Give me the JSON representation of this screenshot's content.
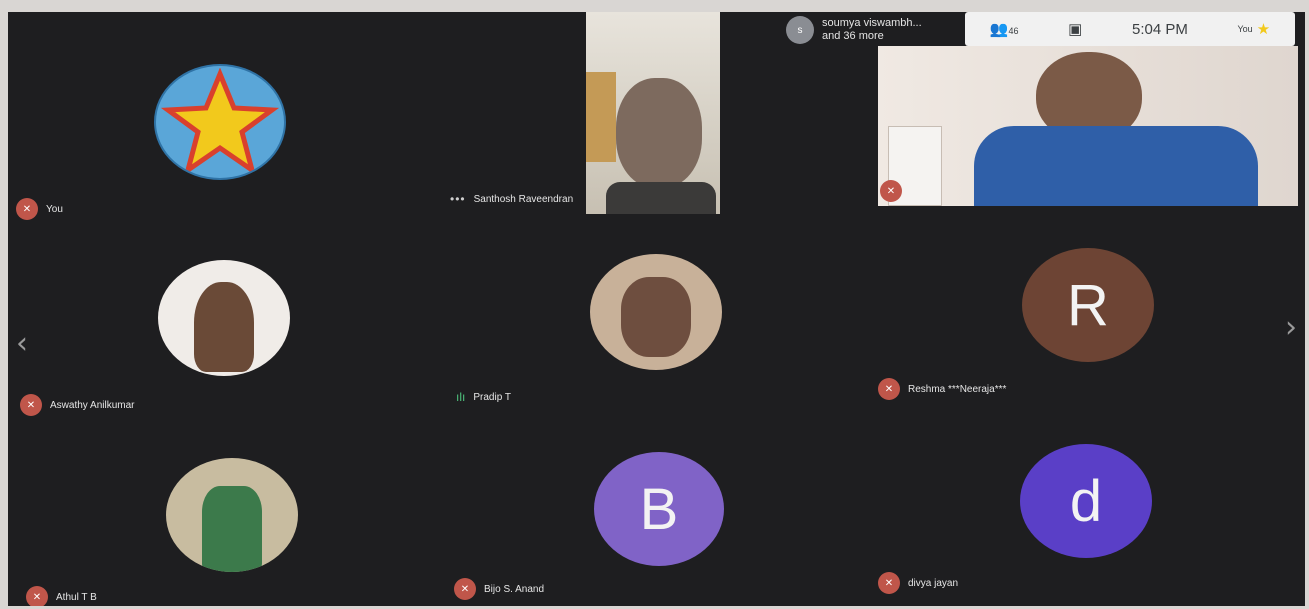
{
  "participants": [
    {
      "name": "You",
      "avatar_icon": "star-icon"
    },
    {
      "name": "Santhosh Raveendran",
      "status_icon": "more-options-icon"
    },
    {
      "name": "",
      "status_icon": "mic-off-icon"
    },
    {
      "name": "Aswathy Anilkumar",
      "avatar_icon": "doll-photo"
    },
    {
      "name": "Pradip T",
      "avatar_icon": "man-photo",
      "status_icon": "speaking-icon"
    },
    {
      "name": "Reshma ***Neeraja***",
      "avatar_letter": "R",
      "avatar_color": "#6d4434"
    },
    {
      "name": "Athul T B",
      "avatar_icon": "man-field-photo"
    },
    {
      "name": "Bijo S. Anand",
      "avatar_letter": "B",
      "avatar_color": "#8063c7"
    },
    {
      "name": "divya jayan",
      "avatar_letter": "d",
      "avatar_color": "#5a3fc7"
    }
  ],
  "others": {
    "name": "soumya viswambh...",
    "more": "and 36 more",
    "badge": "s"
  },
  "statusbar": {
    "participant_count": "46",
    "time": "5:04 PM",
    "self_label": "You"
  },
  "colors": {
    "background": "#1e1e20",
    "mic_off": "#c0564a"
  }
}
